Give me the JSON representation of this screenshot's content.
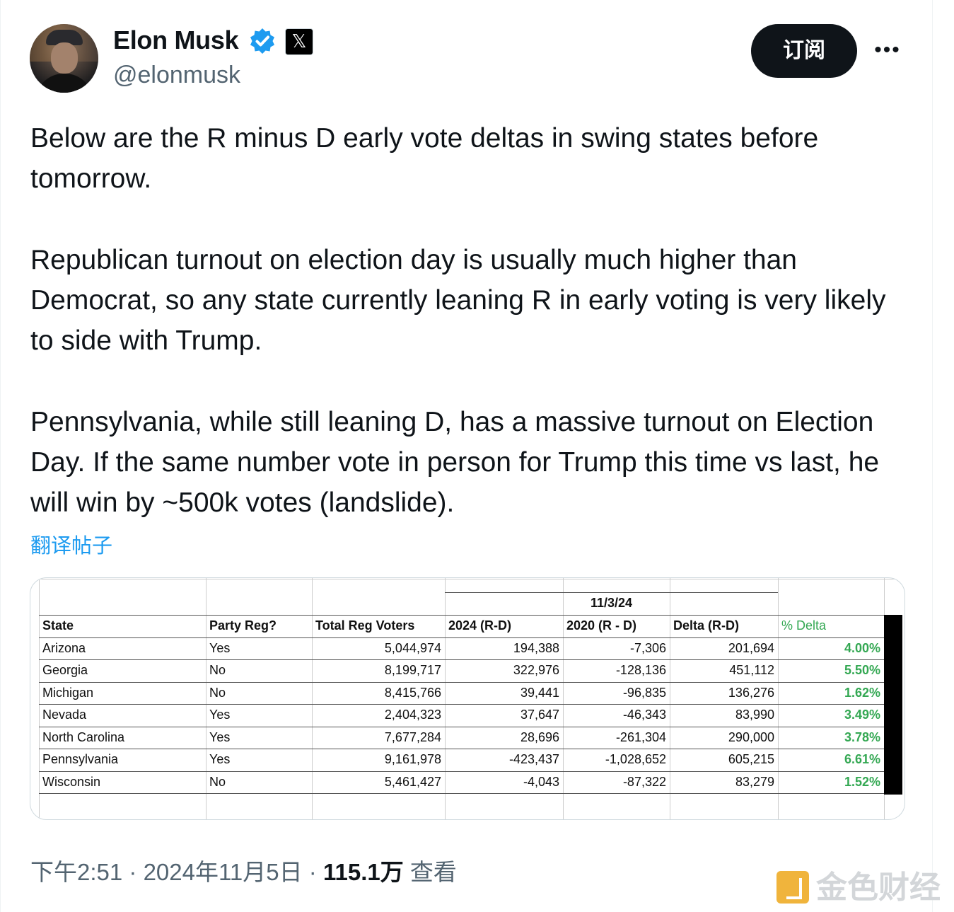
{
  "author": {
    "name": "Elon Musk",
    "handle": "@elonmusk",
    "badge_icon": "x-logo-icon",
    "verified_color": "#1d9bf0"
  },
  "actions": {
    "subscribe_label": "订阅",
    "more_label": "•••"
  },
  "post": {
    "paragraph_1": "Below are the R minus D early vote deltas in swing states before tomorrow.",
    "paragraph_2": "Republican turnout on election day is usually much higher than Democrat, so any state currently leaning R in early voting is very likely to side with Trump.",
    "paragraph_3": "Pennsylvania, while still leaning D, has a massive turnout on Election Day. If the same number vote in person for Trump this time vs last, he will win by ~500k votes (landslide).",
    "translate_label": "翻译帖子"
  },
  "table": {
    "date_header": "11/3/24",
    "columns": [
      "State",
      "Party Reg?",
      "Total Reg Voters",
      "2024 (R-D)",
      "2020 (R - D)",
      "Delta (R-D)",
      "% Delta"
    ],
    "rows": [
      [
        "Arizona",
        "Yes",
        "5,044,974",
        "194,388",
        "-7,306",
        "201,694",
        "4.00%"
      ],
      [
        "Georgia",
        "No",
        "8,199,717",
        "322,976",
        "-128,136",
        "451,112",
        "5.50%"
      ],
      [
        "Michigan",
        "No",
        "8,415,766",
        "39,441",
        "-96,835",
        "136,276",
        "1.62%"
      ],
      [
        "Nevada",
        "Yes",
        "2,404,323",
        "37,647",
        "-46,343",
        "83,990",
        "3.49%"
      ],
      [
        "North Carolina",
        "Yes",
        "7,677,284",
        "28,696",
        "-261,304",
        "290,000",
        "3.78%"
      ],
      [
        "Pennsylvania",
        "Yes",
        "9,161,978",
        "-423,437",
        "-1,028,652",
        "605,215",
        "6.61%"
      ],
      [
        "Wisconsin",
        "No",
        "5,461,427",
        "-4,043",
        "-87,322",
        "83,279",
        "1.52%"
      ]
    ],
    "accent_green": "#34a853"
  },
  "footer": {
    "time": "下午2:51",
    "date": "2024年11月5日",
    "views_count": "115.1万",
    "views_label": "查看",
    "separator": "·"
  },
  "watermark": {
    "text": "金色财经"
  }
}
